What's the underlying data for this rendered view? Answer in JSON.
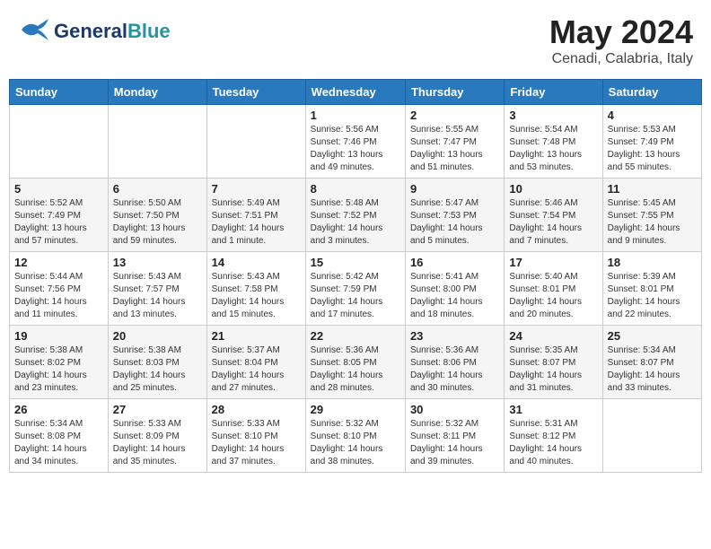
{
  "header": {
    "logo_line1": "General",
    "logo_line2": "Blue",
    "title": "May 2024",
    "location": "Cenadi, Calabria, Italy"
  },
  "weekdays": [
    "Sunday",
    "Monday",
    "Tuesday",
    "Wednesday",
    "Thursday",
    "Friday",
    "Saturday"
  ],
  "weeks": [
    [
      {
        "day": "",
        "info": ""
      },
      {
        "day": "",
        "info": ""
      },
      {
        "day": "",
        "info": ""
      },
      {
        "day": "1",
        "info": "Sunrise: 5:56 AM\nSunset: 7:46 PM\nDaylight: 13 hours\nand 49 minutes."
      },
      {
        "day": "2",
        "info": "Sunrise: 5:55 AM\nSunset: 7:47 PM\nDaylight: 13 hours\nand 51 minutes."
      },
      {
        "day": "3",
        "info": "Sunrise: 5:54 AM\nSunset: 7:48 PM\nDaylight: 13 hours\nand 53 minutes."
      },
      {
        "day": "4",
        "info": "Sunrise: 5:53 AM\nSunset: 7:49 PM\nDaylight: 13 hours\nand 55 minutes."
      }
    ],
    [
      {
        "day": "5",
        "info": "Sunrise: 5:52 AM\nSunset: 7:49 PM\nDaylight: 13 hours\nand 57 minutes."
      },
      {
        "day": "6",
        "info": "Sunrise: 5:50 AM\nSunset: 7:50 PM\nDaylight: 13 hours\nand 59 minutes."
      },
      {
        "day": "7",
        "info": "Sunrise: 5:49 AM\nSunset: 7:51 PM\nDaylight: 14 hours\nand 1 minute."
      },
      {
        "day": "8",
        "info": "Sunrise: 5:48 AM\nSunset: 7:52 PM\nDaylight: 14 hours\nand 3 minutes."
      },
      {
        "day": "9",
        "info": "Sunrise: 5:47 AM\nSunset: 7:53 PM\nDaylight: 14 hours\nand 5 minutes."
      },
      {
        "day": "10",
        "info": "Sunrise: 5:46 AM\nSunset: 7:54 PM\nDaylight: 14 hours\nand 7 minutes."
      },
      {
        "day": "11",
        "info": "Sunrise: 5:45 AM\nSunset: 7:55 PM\nDaylight: 14 hours\nand 9 minutes."
      }
    ],
    [
      {
        "day": "12",
        "info": "Sunrise: 5:44 AM\nSunset: 7:56 PM\nDaylight: 14 hours\nand 11 minutes."
      },
      {
        "day": "13",
        "info": "Sunrise: 5:43 AM\nSunset: 7:57 PM\nDaylight: 14 hours\nand 13 minutes."
      },
      {
        "day": "14",
        "info": "Sunrise: 5:43 AM\nSunset: 7:58 PM\nDaylight: 14 hours\nand 15 minutes."
      },
      {
        "day": "15",
        "info": "Sunrise: 5:42 AM\nSunset: 7:59 PM\nDaylight: 14 hours\nand 17 minutes."
      },
      {
        "day": "16",
        "info": "Sunrise: 5:41 AM\nSunset: 8:00 PM\nDaylight: 14 hours\nand 18 minutes."
      },
      {
        "day": "17",
        "info": "Sunrise: 5:40 AM\nSunset: 8:01 PM\nDaylight: 14 hours\nand 20 minutes."
      },
      {
        "day": "18",
        "info": "Sunrise: 5:39 AM\nSunset: 8:01 PM\nDaylight: 14 hours\nand 22 minutes."
      }
    ],
    [
      {
        "day": "19",
        "info": "Sunrise: 5:38 AM\nSunset: 8:02 PM\nDaylight: 14 hours\nand 23 minutes."
      },
      {
        "day": "20",
        "info": "Sunrise: 5:38 AM\nSunset: 8:03 PM\nDaylight: 14 hours\nand 25 minutes."
      },
      {
        "day": "21",
        "info": "Sunrise: 5:37 AM\nSunset: 8:04 PM\nDaylight: 14 hours\nand 27 minutes."
      },
      {
        "day": "22",
        "info": "Sunrise: 5:36 AM\nSunset: 8:05 PM\nDaylight: 14 hours\nand 28 minutes."
      },
      {
        "day": "23",
        "info": "Sunrise: 5:36 AM\nSunset: 8:06 PM\nDaylight: 14 hours\nand 30 minutes."
      },
      {
        "day": "24",
        "info": "Sunrise: 5:35 AM\nSunset: 8:07 PM\nDaylight: 14 hours\nand 31 minutes."
      },
      {
        "day": "25",
        "info": "Sunrise: 5:34 AM\nSunset: 8:07 PM\nDaylight: 14 hours\nand 33 minutes."
      }
    ],
    [
      {
        "day": "26",
        "info": "Sunrise: 5:34 AM\nSunset: 8:08 PM\nDaylight: 14 hours\nand 34 minutes."
      },
      {
        "day": "27",
        "info": "Sunrise: 5:33 AM\nSunset: 8:09 PM\nDaylight: 14 hours\nand 35 minutes."
      },
      {
        "day": "28",
        "info": "Sunrise: 5:33 AM\nSunset: 8:10 PM\nDaylight: 14 hours\nand 37 minutes."
      },
      {
        "day": "29",
        "info": "Sunrise: 5:32 AM\nSunset: 8:10 PM\nDaylight: 14 hours\nand 38 minutes."
      },
      {
        "day": "30",
        "info": "Sunrise: 5:32 AM\nSunset: 8:11 PM\nDaylight: 14 hours\nand 39 minutes."
      },
      {
        "day": "31",
        "info": "Sunrise: 5:31 AM\nSunset: 8:12 PM\nDaylight: 14 hours\nand 40 minutes."
      },
      {
        "day": "",
        "info": ""
      }
    ]
  ]
}
